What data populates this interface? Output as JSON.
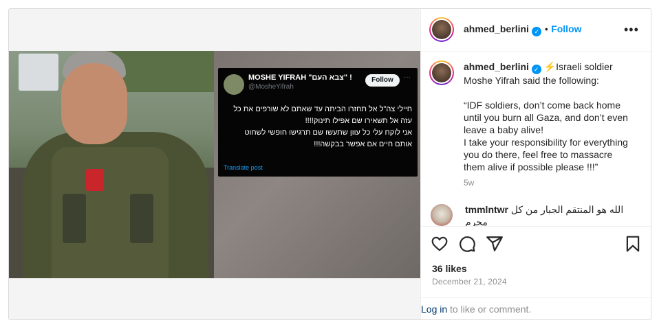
{
  "post": {
    "username": "ahmed_berlini",
    "verified_icon": "✓",
    "dot": "•",
    "follow_label": "Follow",
    "more_icon": "•••"
  },
  "tweet": {
    "name": "MOSHE YIFRAH \"צבא העם\" !",
    "handle": "@MosheYifrah",
    "follow_label": "Follow",
    "more_icon": "···",
    "text_line1": "חיילי צה\"ל אל תחזרו הביתה עד שאתם לא שורפים את כל",
    "text_line2": "עזה אל תשאירו שם אפילו תינוק!!!!",
    "text_line3": "אני לוקח עלי כל עוון שתעשו שם תרגישו חופשי לשחוט",
    "text_line4": "אותם חיים אם אפשר בבקשה!!!",
    "translate_label": "Translate post"
  },
  "caption": {
    "username": "ahmed_berlini",
    "lead": "⚡Israeli soldier",
    "line1": "Moshe Yifrah said the following:",
    "quote1": "“IDF soldiers, don’t come back home",
    "quote2": "until you burn all Gaza, and don’t even",
    "quote3": "leave a baby alive!",
    "quote4": "I take your responsibility for everything",
    "quote5": "you do there, feel free to massacre",
    "quote6": "them alive if possible please !!!”",
    "time": "5w"
  },
  "comment": {
    "username": "tmmlntwr",
    "text": "الله هو المنتقم الجبار من كل مجرم"
  },
  "engagement": {
    "likes": "36 likes",
    "date": "December 21, 2024"
  },
  "footer": {
    "login_label": "Log in",
    "rest_label": " to like or comment."
  },
  "colors": {
    "accent": "#0095f6",
    "text": "#262626",
    "muted": "#8e8e8e"
  }
}
